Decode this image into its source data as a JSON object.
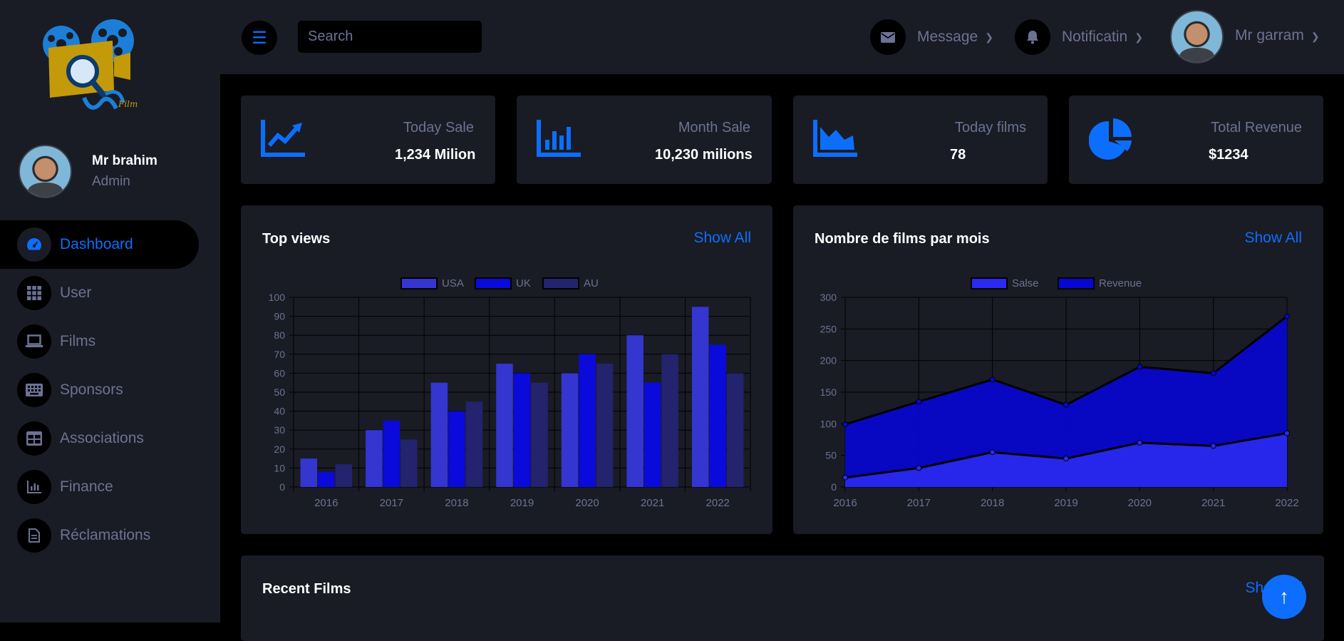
{
  "logo": {
    "alt_text": "شوفلي Film"
  },
  "sidebar": {
    "user": {
      "name": "Mr brahim",
      "role": "Admin"
    },
    "items": [
      {
        "label": "Dashboard",
        "icon": "speedometer-icon",
        "active": true
      },
      {
        "label": "User",
        "icon": "grid-icon",
        "active": false
      },
      {
        "label": "Films",
        "icon": "laptop-icon",
        "active": false
      },
      {
        "label": "Sponsors",
        "icon": "keyboard-icon",
        "active": false
      },
      {
        "label": "Associations",
        "icon": "table-icon",
        "active": false
      },
      {
        "label": "Finance",
        "icon": "chart-icon",
        "active": false
      },
      {
        "label": "Réclamations",
        "icon": "document-icon",
        "active": false
      }
    ]
  },
  "topbar": {
    "search_placeholder": "Search",
    "message_label": "Message",
    "notification_label": "Notificatin",
    "user_name": "Mr garram"
  },
  "stats": [
    {
      "title": "Today Sale",
      "value": "1,234 Milion",
      "icon": "line-chart-icon"
    },
    {
      "title": "Month Sale",
      "value": "10,230 milions",
      "icon": "bar-chart-icon"
    },
    {
      "title": "Today films",
      "value": "78",
      "icon": "area-chart-icon"
    },
    {
      "title": "Total Revenue",
      "value": "$1234",
      "icon": "pie-chart-icon"
    }
  ],
  "panels": {
    "top_views": {
      "title": "Top views",
      "link": "Show All"
    },
    "films_per_month": {
      "title": "Nombre de films par mois",
      "link": "Show All"
    },
    "recent_films": {
      "title": "Recent Films",
      "link": "Show All"
    }
  },
  "colors": {
    "accent": "#0d6efd",
    "panel": "#191c24",
    "muted": "#6c7293"
  },
  "chart_data": [
    {
      "type": "bar",
      "categories": [
        "2016",
        "2017",
        "2018",
        "2019",
        "2020",
        "2021",
        "2022"
      ],
      "series": [
        {
          "name": "USA",
          "values": [
            15,
            30,
            55,
            65,
            60,
            80,
            95
          ],
          "color": "#3535d0"
        },
        {
          "name": "UK",
          "values": [
            8,
            35,
            40,
            60,
            70,
            55,
            75
          ],
          "color": "#0a0adb"
        },
        {
          "name": "AU",
          "values": [
            12,
            25,
            45,
            55,
            65,
            70,
            60
          ],
          "color": "#23236e"
        }
      ],
      "ylim": [
        0,
        100
      ],
      "yticks": [
        0,
        10,
        20,
        30,
        40,
        50,
        60,
        70,
        80,
        90,
        100
      ],
      "legend": "top",
      "grid": true
    },
    {
      "type": "area",
      "categories": [
        "2016",
        "2017",
        "2018",
        "2019",
        "2020",
        "2021",
        "2022"
      ],
      "series": [
        {
          "name": "Salse",
          "values": [
            15,
            30,
            55,
            45,
            70,
            65,
            85
          ],
          "color": "#2a2af0"
        },
        {
          "name": "Revenue",
          "values": [
            99,
            135,
            170,
            130,
            190,
            180,
            270
          ],
          "color": "#0707d0"
        }
      ],
      "ylim": [
        0,
        300
      ],
      "yticks": [
        0,
        50,
        100,
        150,
        200,
        250,
        300
      ],
      "legend": "top",
      "grid": true
    }
  ]
}
